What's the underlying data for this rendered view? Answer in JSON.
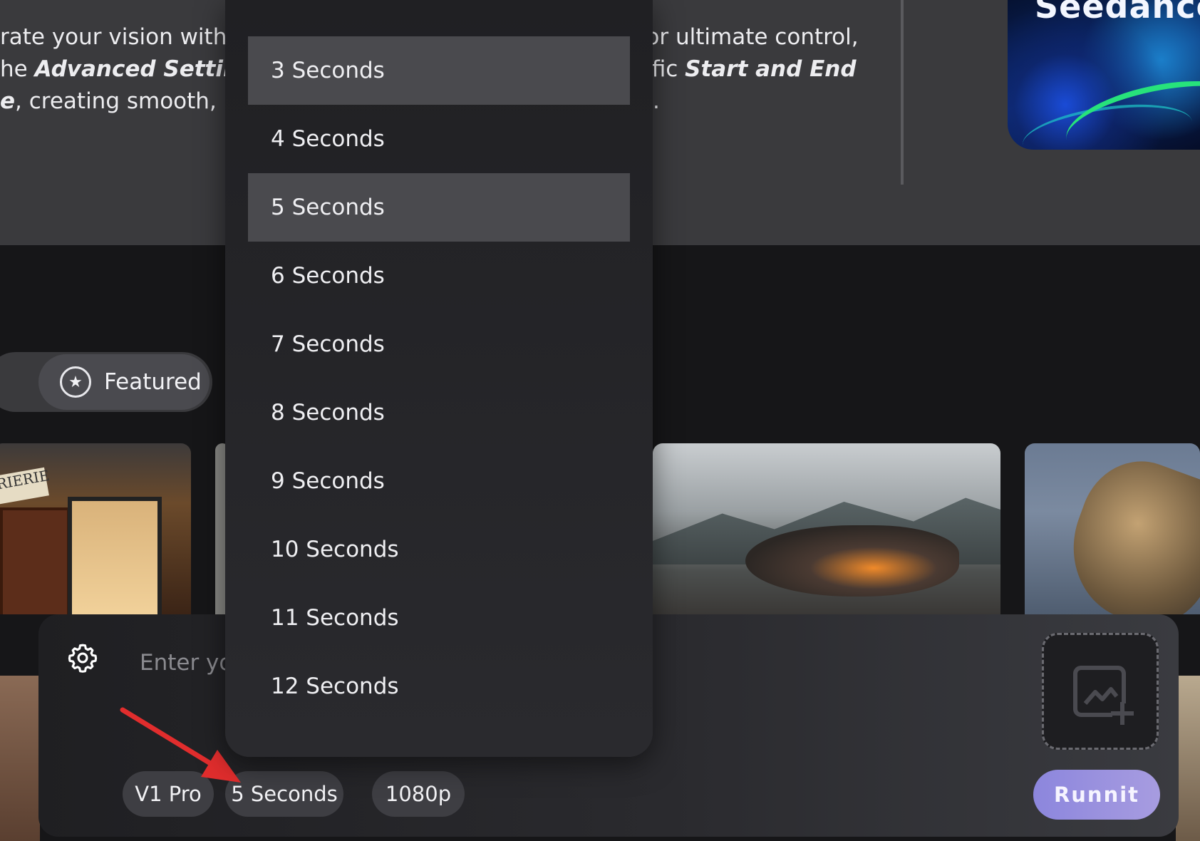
{
  "description": {
    "line1_start": "rate your vision with",
    "line1_end": ". For ultimate control,",
    "line2_start": "he ",
    "line2_bold": "Advanced Setting",
    "line2_end_prefix": "ecific ",
    "line2_end_bold": "Start and End",
    "line3_bold": "e",
    "line3_start": ", creating smooth, p",
    "line3_end": "."
  },
  "hero": {
    "title": "Seedance"
  },
  "filters": {
    "featured_label": "Featured"
  },
  "cards": {
    "bookstore_sign": "RIERIE"
  },
  "composer": {
    "prompt_placeholder": "Enter yo",
    "model_label": "V1 Pro",
    "duration_label": "5 Seconds",
    "resolution_label": "1080p",
    "run_label": "Runnit"
  },
  "duration_dropdown": {
    "options": [
      "3 Seconds",
      "4 Seconds",
      "5 Seconds",
      "6 Seconds",
      "7 Seconds",
      "8 Seconds",
      "9 Seconds",
      "10 Seconds",
      "11 Seconds",
      "12 Seconds"
    ],
    "selected": "5 Seconds"
  },
  "colors": {
    "accent": "#8c86dd",
    "arrow": "#e12d2d"
  },
  "icons": {
    "featured": "star-circle-icon",
    "settings": "gear-icon",
    "upload": "image-add-icon",
    "annotation": "red-arrow-icon"
  }
}
